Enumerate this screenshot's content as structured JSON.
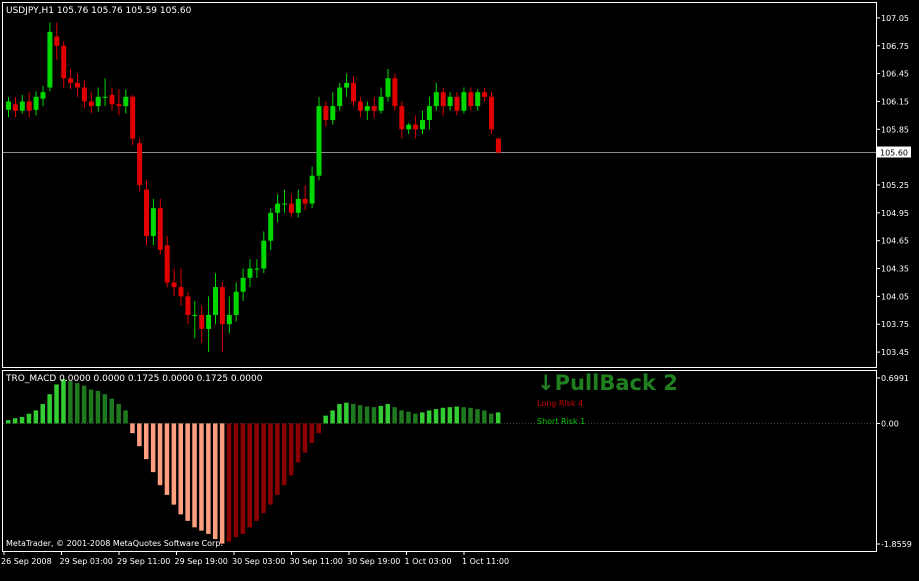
{
  "window": {
    "symbol_info": "USDJPY,H1  105.76 105.76 105.59 105.60",
    "indicator_info": "TRO_MACD 0.0000 0.0000 0.1725 0.0000 0.1725 0.0000",
    "copyright": "MetaTrader, © 2001-2008 MetaQuotes Software Corp."
  },
  "signals": {
    "pullback": "↓PullBack 2",
    "long_risk": "Long Risk 4",
    "short_risk": "Short Risk 1"
  },
  "colors": {
    "background": "#000000",
    "border": "#ffffff",
    "bull": "#00d800",
    "bear": "#e00000",
    "macd_pos_light": "#33cc33",
    "macd_pos_dark": "#1f7a1f",
    "macd_neg_light": "#ff9f80",
    "macd_neg_dark": "#8b0000",
    "price_line": "#8a8a8a",
    "text": "#ffffff",
    "pullback_text": "#208020",
    "long_risk_text": "#cc0000",
    "short_risk_text": "#00cc00"
  },
  "chart_data": [
    {
      "type": "candlestick",
      "title": "USDJPY,H1  105.76 105.76 105.59 105.60",
      "y_ticks": [
        107.05,
        106.75,
        106.45,
        106.15,
        105.85,
        105.25,
        104.95,
        104.65,
        104.35,
        104.05,
        103.75,
        103.45
      ],
      "current_price": 105.6,
      "current_price_label": "105.60",
      "ylim": [
        103.3,
        107.2
      ],
      "x_ticks": [
        "26 Sep 2008",
        "29 Sep 03:00",
        "29 Sep 11:00",
        "29 Sep 19:00",
        "30 Sep 03:00",
        "30 Sep 11:00",
        "30 Sep 19:00",
        "1 Oct 03:00",
        "1 Oct 11:00"
      ],
      "candles": [
        [
          106.06,
          106.15,
          106.2,
          105.98
        ],
        [
          106.12,
          106.05,
          106.2,
          105.98
        ],
        [
          106.05,
          106.15,
          106.22,
          106.02
        ],
        [
          106.15,
          106.05,
          106.25,
          105.98
        ],
        [
          106.06,
          106.2,
          106.26,
          106.0
        ],
        [
          106.18,
          106.25,
          106.32,
          106.1
        ],
        [
          106.3,
          106.9,
          107.0,
          106.26
        ],
        [
          106.85,
          106.75,
          107.0,
          106.6
        ],
        [
          106.75,
          106.4,
          106.8,
          106.3
        ],
        [
          106.4,
          106.35,
          106.5,
          106.28
        ],
        [
          106.35,
          106.3,
          106.45,
          106.2
        ],
        [
          106.3,
          106.15,
          106.38,
          106.08
        ],
        [
          106.15,
          106.1,
          106.25,
          106.02
        ],
        [
          106.1,
          106.2,
          106.3,
          106.04
        ],
        [
          106.2,
          106.2,
          106.4,
          106.1
        ],
        [
          106.22,
          106.12,
          106.3,
          106.05
        ],
        [
          106.12,
          106.1,
          106.28,
          106.0
        ],
        [
          106.1,
          106.2,
          106.28,
          106.02
        ],
        [
          106.2,
          105.75,
          106.22,
          105.68
        ],
        [
          105.7,
          105.25,
          105.75,
          105.18
        ],
        [
          105.2,
          104.7,
          105.3,
          104.6
        ],
        [
          104.7,
          105.0,
          105.1,
          104.6
        ],
        [
          105.0,
          104.55,
          105.1,
          104.5
        ],
        [
          104.6,
          104.2,
          104.7,
          104.15
        ],
        [
          104.2,
          104.15,
          104.35,
          104.05
        ],
        [
          104.15,
          104.05,
          104.35,
          103.95
        ],
        [
          104.05,
          103.85,
          104.1,
          103.75
        ],
        [
          103.85,
          103.85,
          104.0,
          103.6
        ],
        [
          103.85,
          103.7,
          103.95,
          103.55
        ],
        [
          103.7,
          103.85,
          104.05,
          103.45
        ],
        [
          103.85,
          104.15,
          104.3,
          103.75
        ],
        [
          104.15,
          103.75,
          104.2,
          103.45
        ],
        [
          103.75,
          103.85,
          104.05,
          103.65
        ],
        [
          103.85,
          104.1,
          104.2,
          103.78
        ],
        [
          104.1,
          104.25,
          104.35,
          104.0
        ],
        [
          104.25,
          104.35,
          104.45,
          104.15
        ],
        [
          104.35,
          104.35,
          104.45,
          104.25
        ],
        [
          104.35,
          104.65,
          104.75,
          104.3
        ],
        [
          104.65,
          104.95,
          105.0,
          104.55
        ],
        [
          104.95,
          105.05,
          105.15,
          104.85
        ],
        [
          105.05,
          105.05,
          105.2,
          104.95
        ],
        [
          105.05,
          104.95,
          105.15,
          104.9
        ],
        [
          104.95,
          105.1,
          105.2,
          104.9
        ],
        [
          105.1,
          105.05,
          105.25,
          104.98
        ],
        [
          105.05,
          105.35,
          105.45,
          105.0
        ],
        [
          105.35,
          106.1,
          106.2,
          105.3
        ],
        [
          106.1,
          105.95,
          106.15,
          105.88
        ],
        [
          105.95,
          106.1,
          106.25,
          105.9
        ],
        [
          106.1,
          106.3,
          106.35,
          106.05
        ],
        [
          106.3,
          106.35,
          106.45,
          106.2
        ],
        [
          106.35,
          106.15,
          106.42,
          106.1
        ],
        [
          106.15,
          106.05,
          106.2,
          105.98
        ],
        [
          106.05,
          106.1,
          106.15,
          105.95
        ],
        [
          106.1,
          106.05,
          106.2,
          105.98
        ],
        [
          106.05,
          106.2,
          106.3,
          106.02
        ],
        [
          106.2,
          106.4,
          106.5,
          106.15
        ],
        [
          106.4,
          106.1,
          106.45,
          106.05
        ],
        [
          106.1,
          105.85,
          106.15,
          105.75
        ],
        [
          105.85,
          105.9,
          105.92,
          105.8
        ],
        [
          105.9,
          105.85,
          106.0,
          105.75
        ],
        [
          105.85,
          105.95,
          106.05,
          105.8
        ],
        [
          105.95,
          106.1,
          106.2,
          105.85
        ],
        [
          106.1,
          106.25,
          106.35,
          106.05
        ],
        [
          106.25,
          106.1,
          106.3,
          106.0
        ],
        [
          106.1,
          106.2,
          106.25,
          106.05
        ],
        [
          106.2,
          106.05,
          106.25,
          106.0
        ],
        [
          106.05,
          106.25,
          106.3,
          106.02
        ],
        [
          106.25,
          106.1,
          106.3,
          106.05
        ],
        [
          106.1,
          106.25,
          106.28,
          106.05
        ],
        [
          106.25,
          106.2,
          106.3,
          106.15
        ],
        [
          106.2,
          105.85,
          106.25,
          105.8
        ],
        [
          105.75,
          105.6,
          105.76,
          105.59
        ]
      ]
    },
    {
      "type": "bar",
      "title": "TRO_MACD 0.0000 0.0000 0.1725 0.0000 0.1725 0.0000",
      "y_ticks_labels": [
        "0.6991",
        "0.00",
        "-1.8559"
      ],
      "ylim": [
        -1.8559,
        0.6991
      ],
      "values": [
        0.05,
        0.08,
        0.1,
        0.15,
        0.2,
        0.3,
        0.45,
        0.6,
        0.68,
        0.65,
        0.62,
        0.58,
        0.52,
        0.5,
        0.45,
        0.38,
        0.3,
        0.2,
        -0.15,
        -0.35,
        -0.55,
        -0.75,
        -0.95,
        -1.1,
        -1.25,
        -1.4,
        -1.5,
        -1.6,
        -1.65,
        -1.7,
        -1.78,
        -1.85,
        -1.82,
        -1.75,
        -1.7,
        -1.6,
        -1.5,
        -1.38,
        -1.25,
        -1.1,
        -0.95,
        -0.8,
        -0.6,
        -0.45,
        -0.3,
        -0.15,
        0.12,
        0.2,
        0.3,
        0.32,
        0.3,
        0.28,
        0.26,
        0.25,
        0.27,
        0.3,
        0.25,
        0.2,
        0.18,
        0.15,
        0.17,
        0.2,
        0.22,
        0.24,
        0.25,
        0.26,
        0.25,
        0.24,
        0.22,
        0.2,
        0.15,
        0.17
      ]
    }
  ]
}
